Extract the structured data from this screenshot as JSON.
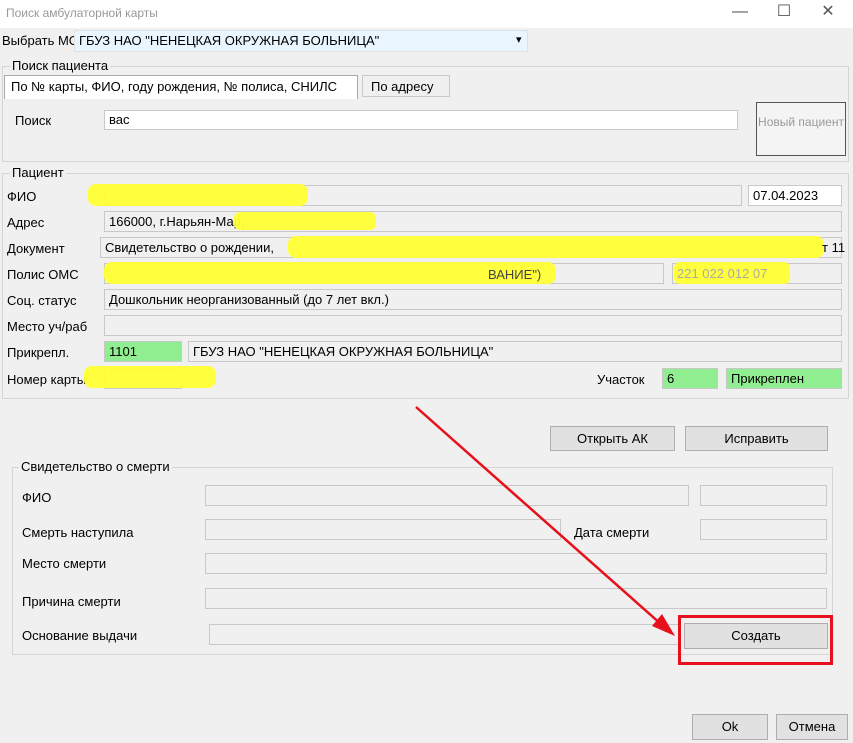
{
  "window": {
    "title": "Поиск амбулаторной карты",
    "minimize": "—",
    "maximize": "☐",
    "close": "✕"
  },
  "mo": {
    "label": "Выбрать МО",
    "value": "ГБУЗ НАО \"НЕНЕЦКАЯ ОКРУЖНАЯ БОЛЬНИЦА\"",
    "arrow": "▾"
  },
  "search": {
    "group_title": "Поиск пациента",
    "tabs": [
      "По № карты, ФИО, году рождения, № полиса, СНИЛС",
      "По адресу"
    ],
    "label": "Поиск",
    "value": "вас",
    "new_patient_button": "Новый пациент"
  },
  "patient": {
    "group_title": "Пациент",
    "fio_label": "ФИО",
    "birth_date": "07.04.2023",
    "address_label": "Адрес",
    "address_value": "166000, г.Нарьян-Мар,",
    "document_label": "Документ",
    "document_value": "Свидетельство о рождении,",
    "document_suffix": "т 11",
    "policy_label": "Полис ОМС",
    "policy_fragment": "ВАНИЕ\")",
    "policy_number": "221 022 012 07",
    "social_label": "Соц. статус",
    "social_value": "Дошкольник неорганизованный (до 7 лет вкл.)",
    "work_label": "Место уч/раб",
    "work_value": "",
    "attach_label": "Прикрепл.",
    "attach_code": "1101",
    "attach_org": "ГБУЗ НАО \"НЕНЕЦКАЯ ОКРУЖНАЯ БОЛЬНИЦА\"",
    "card_label": "Номер карты",
    "district_label": "Участок",
    "district_value": "6",
    "attach_status": "Прикреплен"
  },
  "actions": {
    "open_ak": "Открыть АК",
    "edit": "Исправить"
  },
  "death": {
    "group_title": "Свидетельство о смерти",
    "fio_label": "ФИО",
    "occurred_label": "Смерть наступила",
    "date_label": "Дата смерти",
    "place_label": "Место смерти",
    "cause_label": "Причина смерти",
    "basis_label": "Основание выдачи",
    "create_button": "Создать"
  },
  "footer": {
    "ok": "Ok",
    "cancel": "Отмена"
  },
  "colors": {
    "annotation": "#e8101a",
    "highlight": "#ffff33",
    "attached": "#90ee90"
  }
}
